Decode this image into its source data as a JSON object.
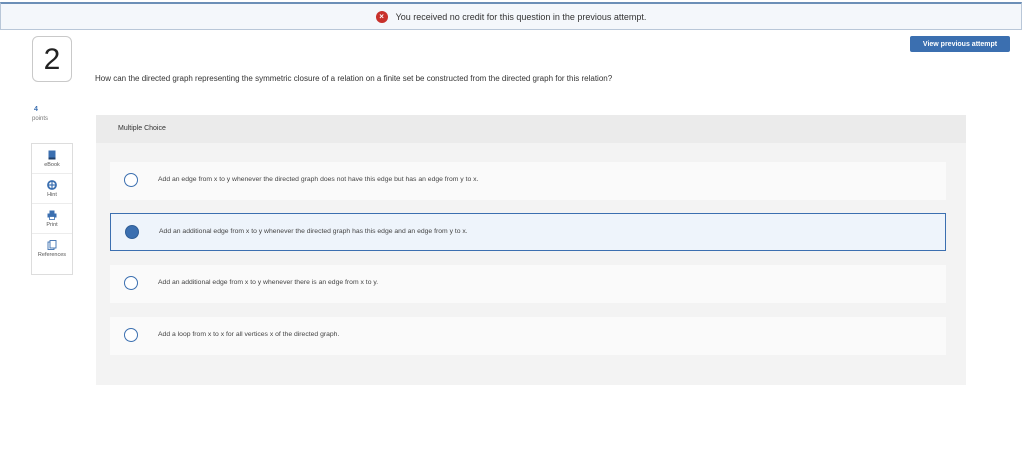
{
  "banner": {
    "message": "You received no credit for this question in the previous attempt."
  },
  "question": {
    "number": "2",
    "text": "How can the directed graph representing the symmetric closure of a relation on a finite set be constructed from the directed graph for this relation?",
    "points_value": "4",
    "points_label": "points"
  },
  "view_previous_label": "View previous attempt",
  "tools": [
    {
      "label": "eBook",
      "icon": "book-icon"
    },
    {
      "label": "Hint",
      "icon": "lifebuoy-icon"
    },
    {
      "label": "Print",
      "icon": "printer-icon"
    },
    {
      "label": "References",
      "icon": "references-icon"
    }
  ],
  "multiple_choice": {
    "header": "Multiple Choice",
    "options": [
      {
        "text": "Add an edge from x to y whenever the directed graph does not have this edge but has an edge from y to x.",
        "selected": false
      },
      {
        "text": "Add an additional edge from x to y whenever the directed graph has this edge and an edge from y to x.",
        "selected": true
      },
      {
        "text": "Add an additional edge from x to y whenever there is an edge from x to y.",
        "selected": false
      },
      {
        "text": "Add a loop from x to x for all vertices x of the directed graph.",
        "selected": false
      }
    ]
  },
  "colors": {
    "accent": "#3b6fb0",
    "error": "#c8312b"
  }
}
